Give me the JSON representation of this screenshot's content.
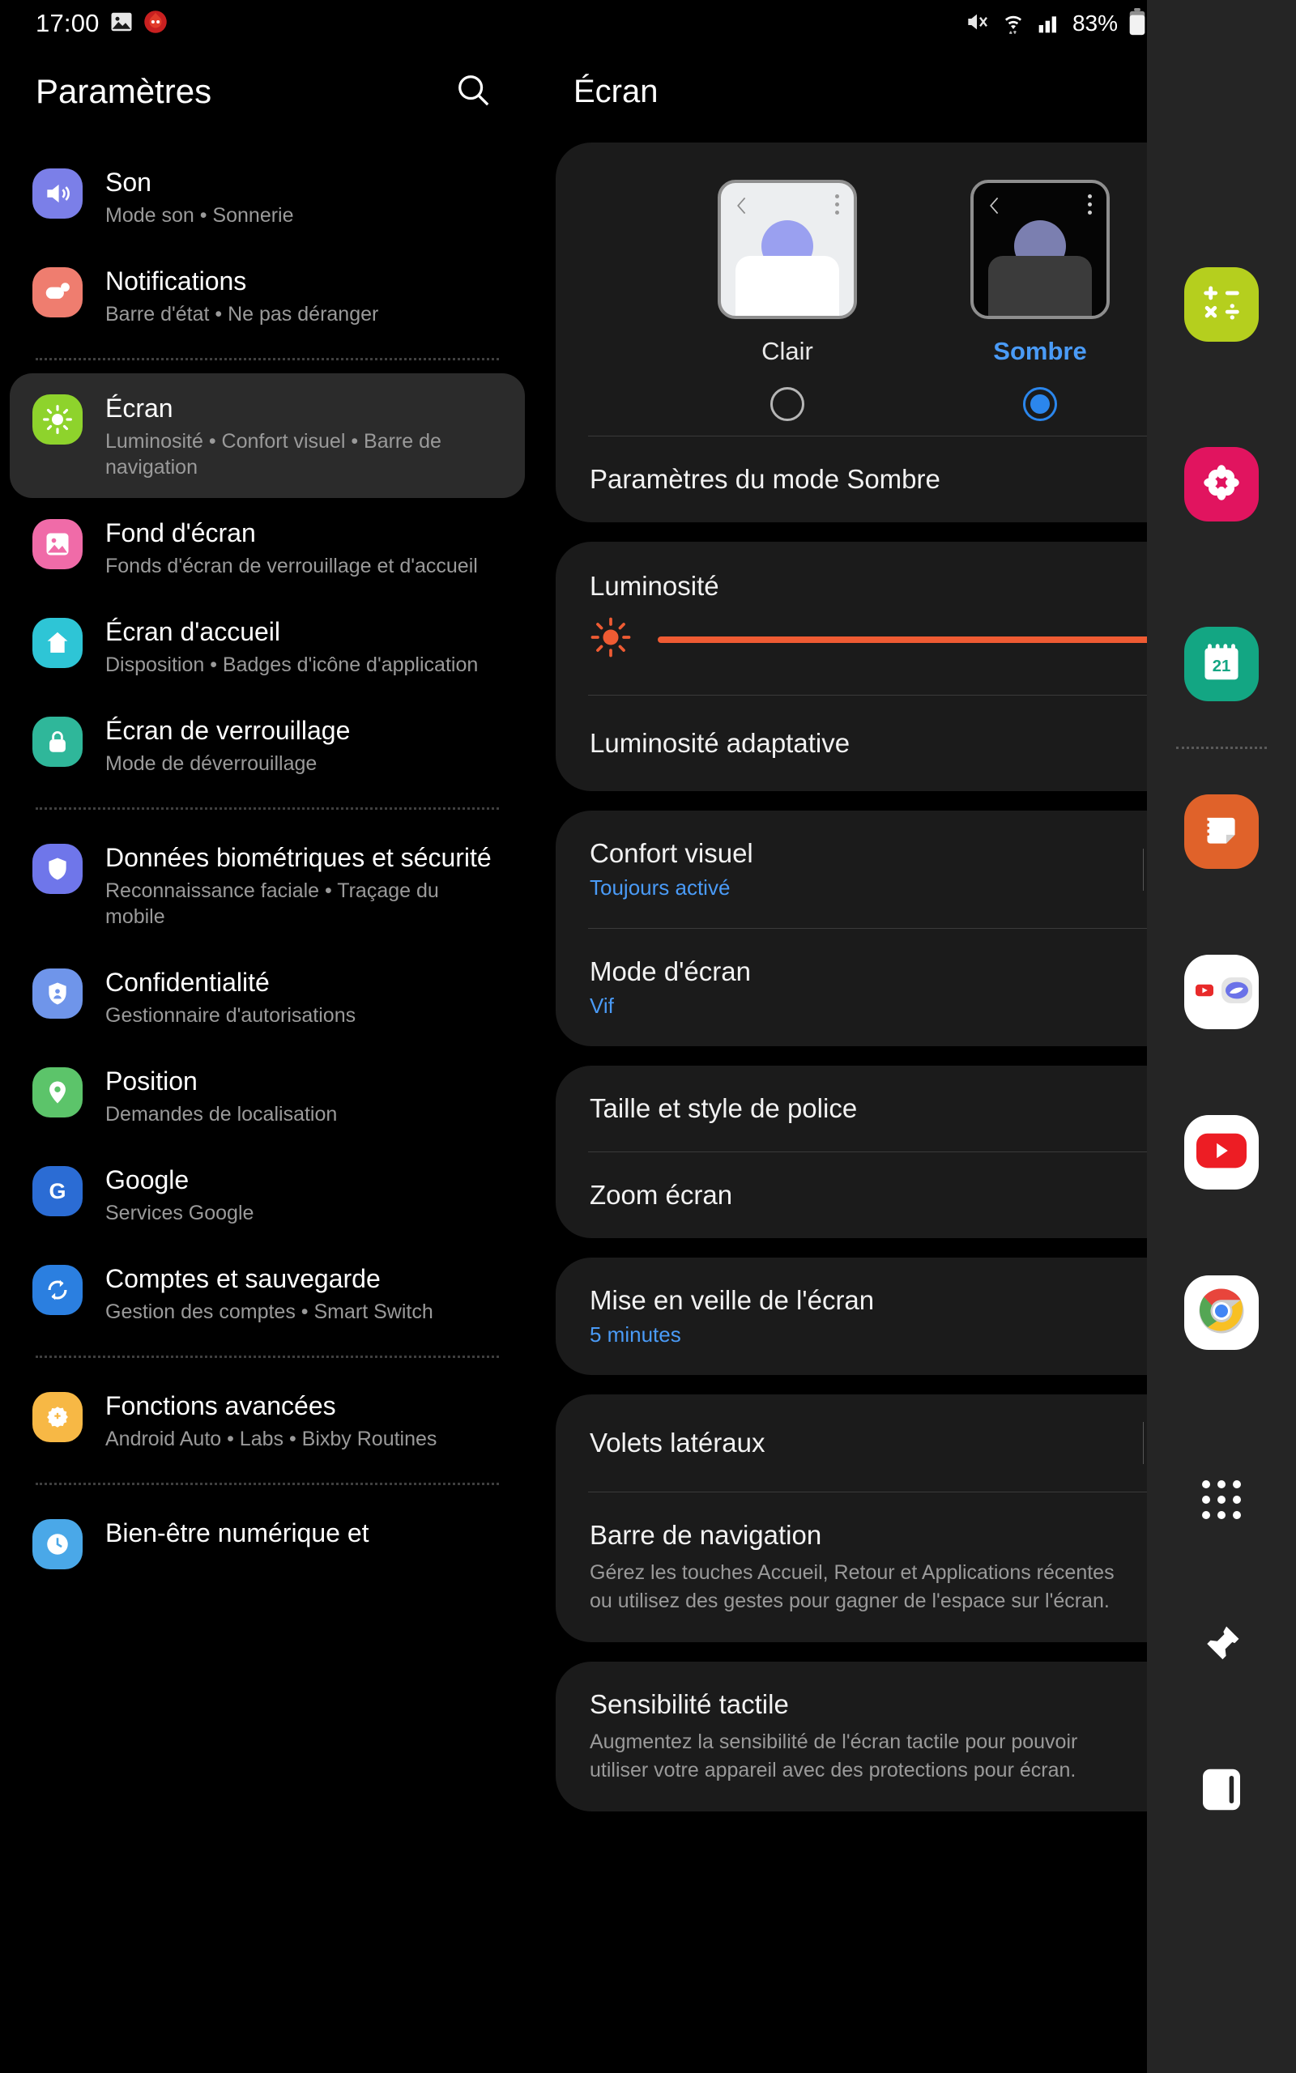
{
  "status_bar": {
    "time": "17:00",
    "left_icons": [
      "image-icon",
      "app-notification-icon"
    ],
    "right_icons": [
      "mute-icon",
      "wifi-icon",
      "signal-icon"
    ],
    "battery_text": "83%"
  },
  "sidebar": {
    "title": "Paramètres",
    "search_icon": "search-icon",
    "items": [
      {
        "id": "son",
        "title": "Son",
        "subtitle": "Mode son  •  Sonnerie",
        "icon": "sound-icon",
        "color": "#7b7fe8",
        "selected": false
      },
      {
        "id": "notifications",
        "title": "Notifications",
        "subtitle": "Barre d'état  •  Ne pas déranger",
        "icon": "notification-icon",
        "color": "#ef7d6f",
        "selected": false
      },
      {
        "id": "ecran",
        "title": "Écran",
        "subtitle": "Luminosité  •  Confort visuel  •  Barre de navigation",
        "icon": "brightness-icon",
        "color": "#8ed32c",
        "selected": true
      },
      {
        "id": "fond-ecran",
        "title": "Fond d'écran",
        "subtitle": "Fonds d'écran de verrouillage et d'accueil",
        "icon": "wallpaper-icon",
        "color": "#f06ba8",
        "selected": false
      },
      {
        "id": "ecran-accueil",
        "title": "Écran d'accueil",
        "subtitle": "Disposition  •  Badges d'icône d'application",
        "icon": "home-icon",
        "color": "#2ec5d6",
        "selected": false
      },
      {
        "id": "ecran-verrouillage",
        "title": "Écran de verrouillage",
        "subtitle": "Mode de déverrouillage",
        "icon": "lock-icon",
        "color": "#2fb79a",
        "selected": false
      },
      {
        "id": "biometrie",
        "title": "Données biométriques et sécurité",
        "subtitle": "Reconnaissance faciale  •  Traçage du mobile",
        "icon": "shield-icon",
        "color": "#6f76ea",
        "selected": false
      },
      {
        "id": "confidentialite",
        "title": "Confidentialité",
        "subtitle": "Gestionnaire d'autorisations",
        "icon": "privacy-shield-icon",
        "color": "#6f95ea",
        "selected": false
      },
      {
        "id": "position",
        "title": "Position",
        "subtitle": "Demandes de localisation",
        "icon": "location-pin-icon",
        "color": "#5cc46a",
        "selected": false
      },
      {
        "id": "google",
        "title": "Google",
        "subtitle": "Services Google",
        "icon": "google-g-icon",
        "color": "#2b6cd4",
        "selected": false
      },
      {
        "id": "comptes",
        "title": "Comptes et sauvegarde",
        "subtitle": "Gestion des comptes  •  Smart Switch",
        "icon": "sync-icon",
        "color": "#2b7fe0",
        "selected": false
      },
      {
        "id": "fonctions-avancees",
        "title": "Fonctions avancées",
        "subtitle": "Android Auto  •  Labs  •  Bixby Routines",
        "icon": "advanced-gear-icon",
        "color": "#f7b845",
        "selected": false
      },
      {
        "id": "bien-etre",
        "title": "Bien-être numérique et",
        "subtitle": "",
        "icon": "wellbeing-icon",
        "color": "#4aa8e8",
        "selected": false
      }
    ],
    "separators_after": [
      "notifications",
      "ecran-verrouillage",
      "comptes",
      "fonctions-avancees"
    ]
  },
  "detail": {
    "title": "Écran",
    "theme": {
      "options": [
        {
          "id": "clair",
          "label": "Clair",
          "selected": false
        },
        {
          "id": "sombre",
          "label": "Sombre",
          "selected": true
        }
      ],
      "dark_mode_settings_label": "Paramètres du mode Sombre"
    },
    "brightness": {
      "label": "Luminosité",
      "icon": "brightness-sun-icon",
      "value_percent": 100,
      "track_color": "#ef5b33",
      "knob_color": "#f4701f",
      "adaptive": {
        "label": "Luminosité adaptative",
        "enabled": false
      }
    },
    "eye_comfort": {
      "label": "Confort visuel",
      "sub": "Toujours activé",
      "enabled": false
    },
    "screen_mode": {
      "label": "Mode d'écran",
      "sub": "Vif"
    },
    "font": {
      "label": "Taille et style de police"
    },
    "zoom": {
      "label": "Zoom écran"
    },
    "screen_timeout": {
      "label": "Mise en veille de l'écran",
      "sub": "5 minutes"
    },
    "edge_panels": {
      "label": "Volets latéraux",
      "enabled": true
    },
    "nav_bar": {
      "label": "Barre de navigation",
      "desc": "Gérez les touches Accueil, Retour et Applications récentes ou utilisez des gestes pour gagner de l'espace sur l'écran."
    },
    "touch_sensitivity": {
      "label": "Sensibilité tactile",
      "desc": "Augmentez la sensibilité de l'écran tactile pour pouvoir utiliser votre appareil avec des protections pour écran.",
      "enabled": false
    }
  },
  "edge_panel": {
    "apps": [
      {
        "id": "calculatrice",
        "icon": "calculator-icon",
        "color": "#b5cf1e"
      },
      {
        "id": "galerie",
        "icon": "gallery-flower-icon",
        "color": "#e1145f"
      },
      {
        "id": "calendrier",
        "icon": "calendar-icon",
        "color": "#13a683",
        "badge": "21"
      },
      {
        "id": "notes",
        "icon": "notes-icon",
        "color": "#e0622a"
      },
      {
        "id": "youtube-internet-pair",
        "icon": "app-pair-icon",
        "color": "#f4f4f4"
      },
      {
        "id": "youtube",
        "icon": "youtube-icon",
        "color": "#ffffff"
      },
      {
        "id": "chrome",
        "icon": "chrome-icon",
        "color": "#ffffff"
      }
    ],
    "tools": [
      {
        "id": "toutes-les-applications",
        "icon": "apps-grid-icon"
      },
      {
        "id": "epingler",
        "icon": "pin-icon"
      },
      {
        "id": "ecran-partage",
        "icon": "split-screen-icon"
      }
    ]
  },
  "colors": {
    "accent_blue": "#4a9bf7",
    "toggle_on": "#1a8cff",
    "brightness": "#ef5b33",
    "card_bg": "#1b1b1b"
  }
}
